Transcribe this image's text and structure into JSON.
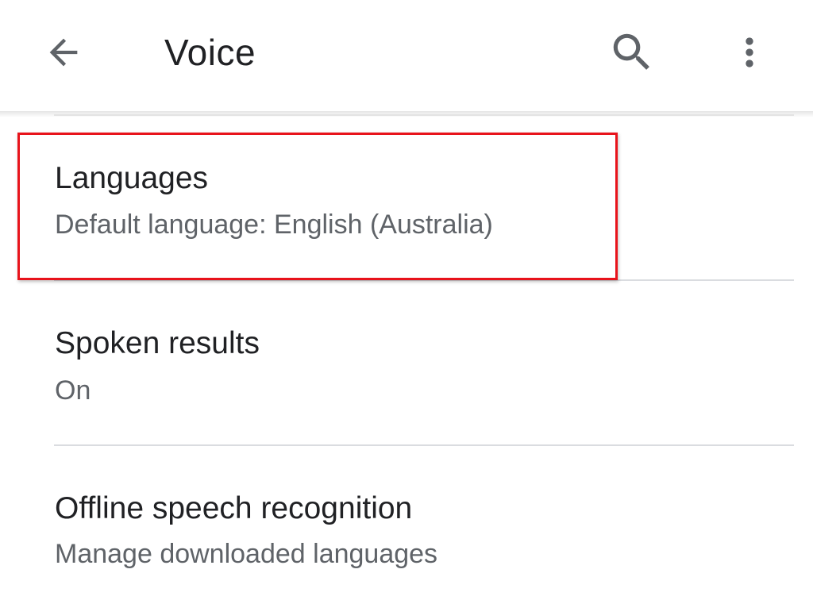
{
  "appbar": {
    "title": "Voice",
    "icons": {
      "back": "arrow-back-icon",
      "search": "search-icon",
      "more": "more-vert-icon"
    }
  },
  "settings": {
    "items": [
      {
        "title": "Languages",
        "summary": "Default language: English (Australia)"
      },
      {
        "title": "Spoken results",
        "summary": "On"
      },
      {
        "title": "Offline speech recognition",
        "summary": "Manage downloaded languages"
      }
    ]
  },
  "annotation": {
    "highlight_color": "#e8131b",
    "highlighted_item": "Languages"
  },
  "colors": {
    "title_text": "#202124",
    "summary_text": "#5f6368",
    "icon": "#5f6368",
    "divider": "#dadce0"
  }
}
